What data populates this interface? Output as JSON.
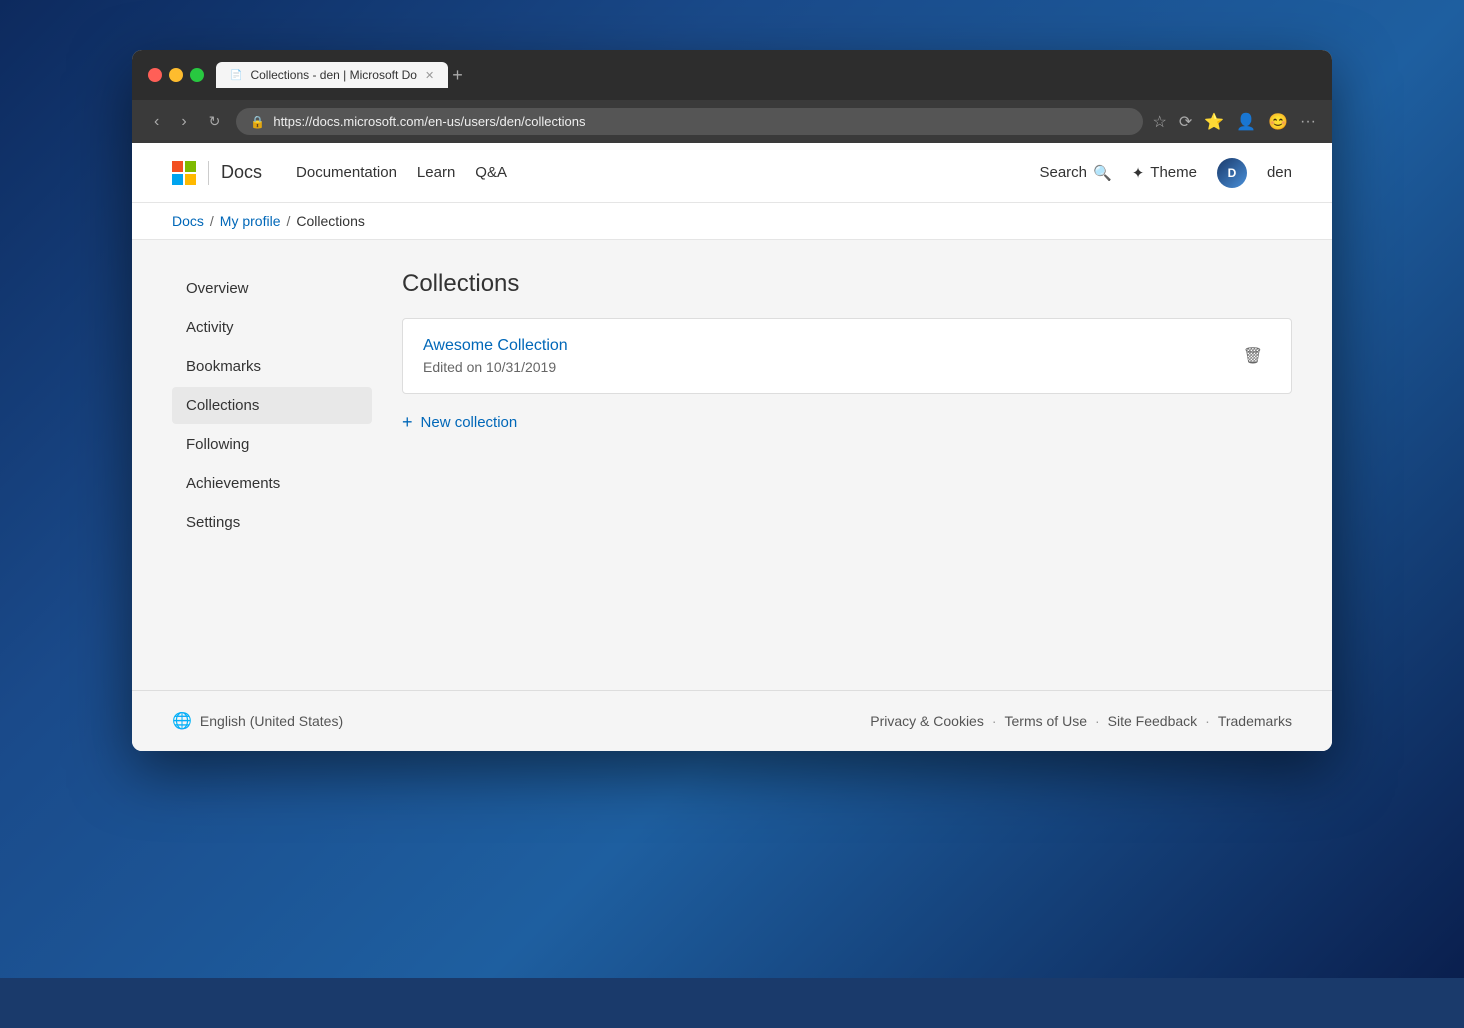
{
  "desktop": {
    "bg": "cityscape night"
  },
  "browser": {
    "tab_title": "Collections - den | Microsoft Do",
    "tab_favicon": "🟦",
    "url": "https://docs.microsoft.com/en-us/users/den/collections",
    "url_domain": "docs.microsoft.com",
    "url_path": "/en-us/users/den/collections"
  },
  "header": {
    "brand": "Microsoft",
    "app": "Docs",
    "nav": [
      {
        "label": "Documentation"
      },
      {
        "label": "Learn"
      },
      {
        "label": "Q&A"
      }
    ],
    "search_label": "Search",
    "theme_label": "Theme",
    "user_name": "den",
    "user_initials": "D"
  },
  "breadcrumb": {
    "items": [
      "Docs",
      "My profile",
      "Collections"
    ]
  },
  "sidebar": {
    "items": [
      {
        "label": "Overview",
        "active": false
      },
      {
        "label": "Activity",
        "active": false
      },
      {
        "label": "Bookmarks",
        "active": false
      },
      {
        "label": "Collections",
        "active": true
      },
      {
        "label": "Following",
        "active": false
      },
      {
        "label": "Achievements",
        "active": false
      },
      {
        "label": "Settings",
        "active": false
      }
    ]
  },
  "main": {
    "title": "Collections",
    "collections": [
      {
        "name": "Awesome Collection",
        "edited": "Edited on 10/31/2019"
      }
    ],
    "new_collection_label": "New collection"
  },
  "footer": {
    "locale": "English (United States)",
    "links": [
      "Privacy & Cookies",
      "Terms of Use",
      "Site Feedback",
      "Trademarks"
    ]
  }
}
